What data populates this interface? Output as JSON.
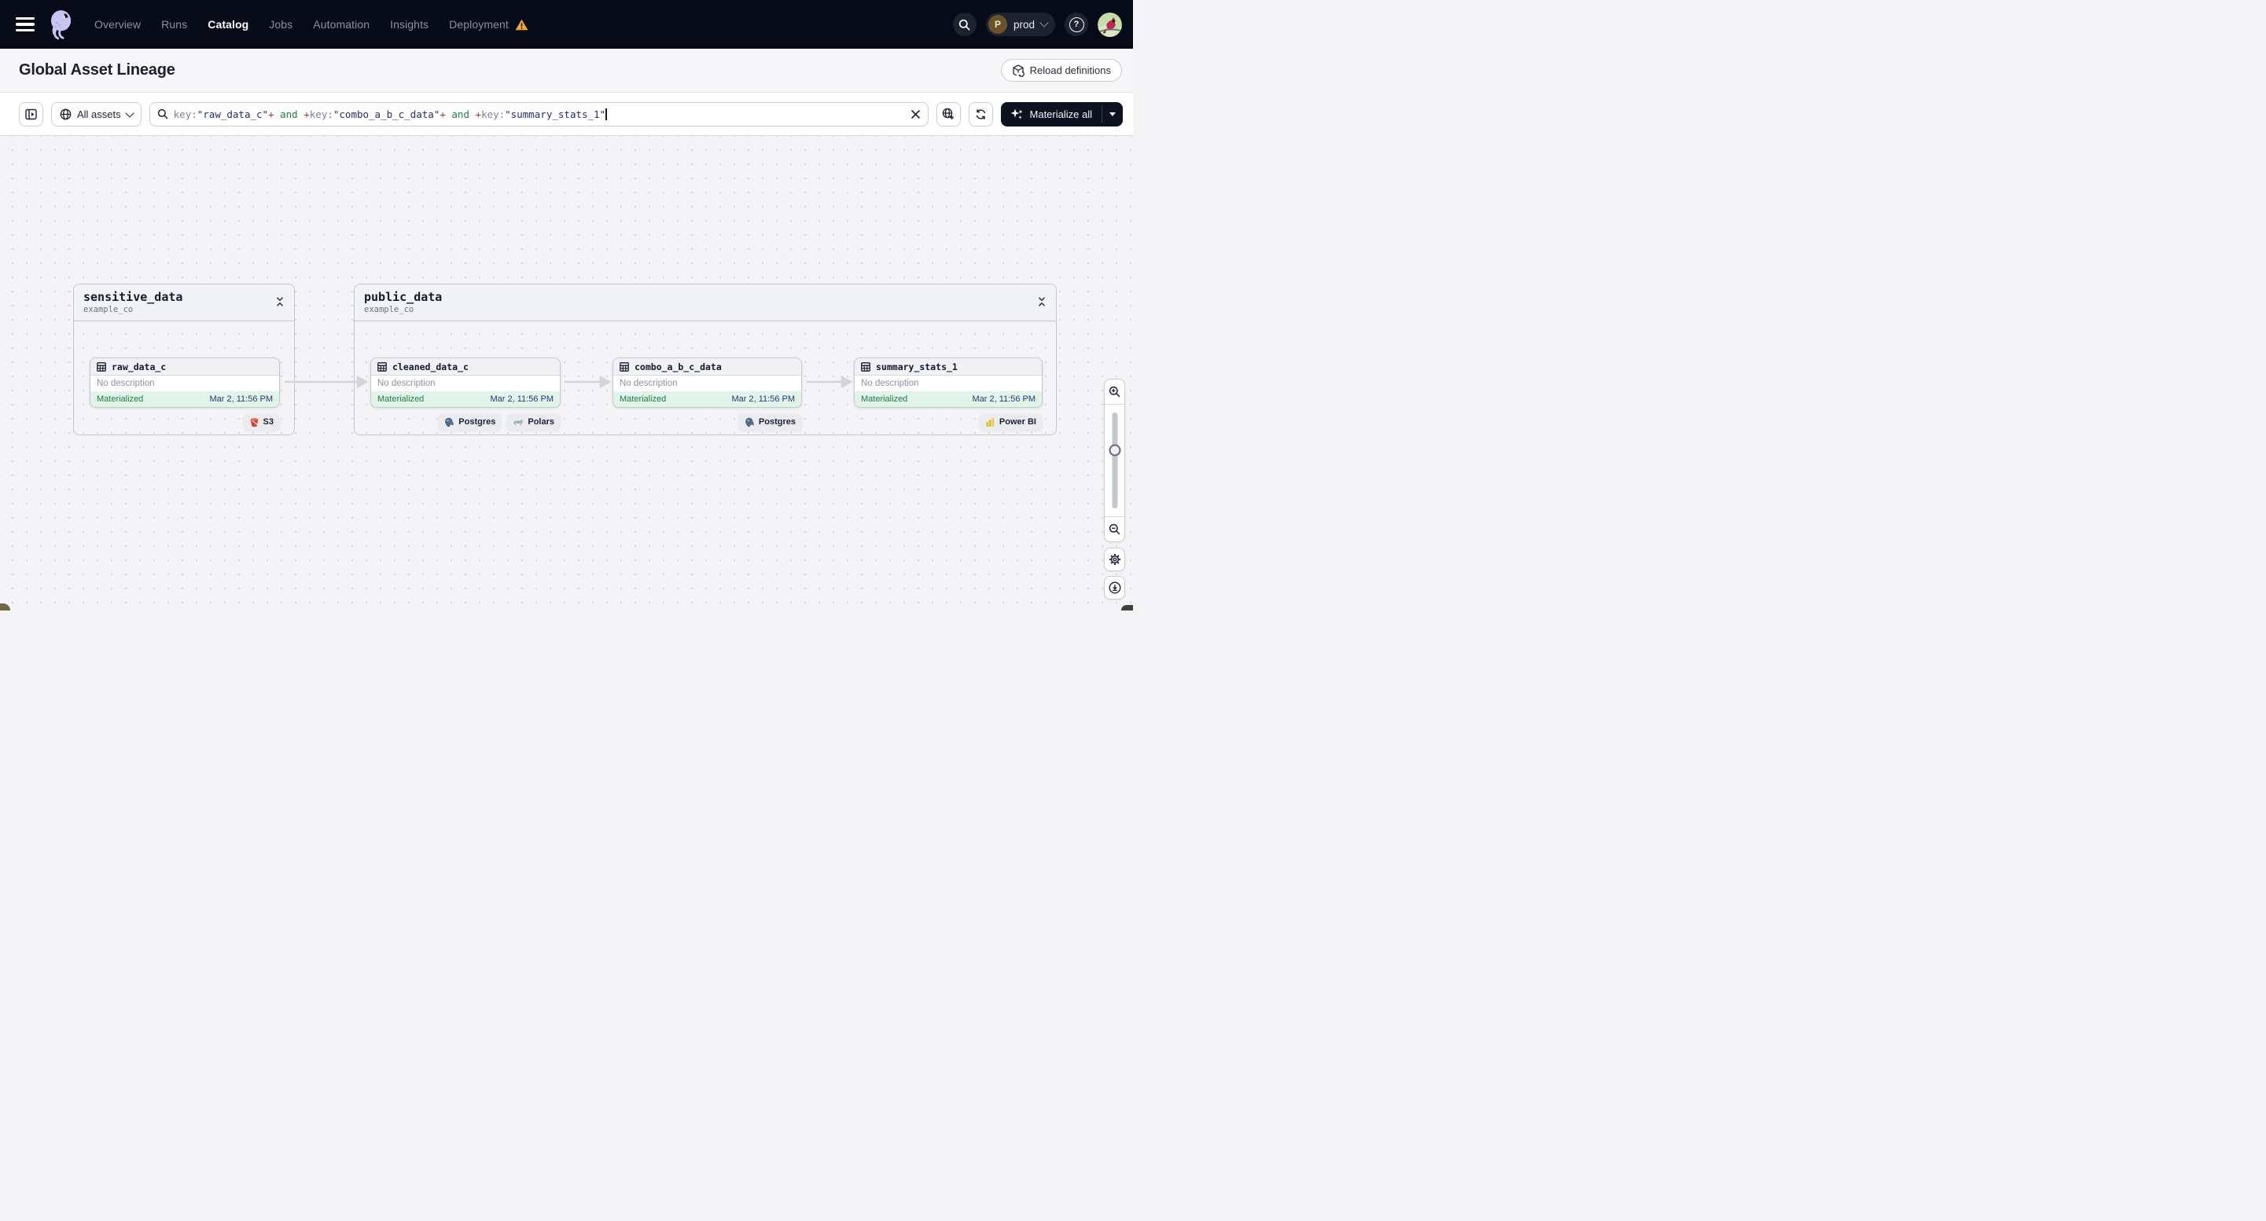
{
  "nav": {
    "items": [
      "Overview",
      "Runs",
      "Catalog",
      "Jobs",
      "Automation",
      "Insights",
      "Deployment"
    ],
    "active_item": "Catalog",
    "help_label": "?",
    "environment": {
      "initial": "P",
      "name": "prod"
    }
  },
  "page": {
    "title": "Global Asset Lineage",
    "reload_button": "Reload definitions"
  },
  "toolbar": {
    "scope_selector": "All assets",
    "materialize_button": "Materialize all",
    "query": [
      {
        "t": "key:",
        "c": "attr"
      },
      {
        "t": "\"raw_data_c\"",
        "c": "str"
      },
      {
        "t": "+",
        "c": "op"
      },
      {
        "t": " and ",
        "c": "kw"
      },
      {
        "t": "+",
        "c": "op"
      },
      {
        "t": "key:",
        "c": "attr"
      },
      {
        "t": "\"combo_a_b_c_data\"",
        "c": "str"
      },
      {
        "t": "+",
        "c": "op"
      },
      {
        "t": " and ",
        "c": "kw"
      },
      {
        "t": "+",
        "c": "op"
      },
      {
        "t": "key:",
        "c": "attr"
      },
      {
        "t": "\"summary_stats_1\"",
        "c": "str"
      }
    ]
  },
  "graph": {
    "groups": [
      {
        "name": "sensitive_data",
        "location": "example_co"
      },
      {
        "name": "public_data",
        "location": "example_co"
      }
    ],
    "nodes": [
      {
        "name": "raw_data_c",
        "description": "No description",
        "status": "Materialized",
        "timestamp": "Mar 2, 11:56 PM",
        "badges": [
          {
            "label": "S3",
            "icon": "s3"
          }
        ]
      },
      {
        "name": "cleaned_data_c",
        "description": "No description",
        "status": "Materialized",
        "timestamp": "Mar 2, 11:56 PM",
        "badges": [
          {
            "label": "Postgres",
            "icon": "postgres"
          },
          {
            "label": "Polars",
            "icon": "polars"
          }
        ]
      },
      {
        "name": "combo_a_b_c_data",
        "description": "No description",
        "status": "Materialized",
        "timestamp": "Mar 2, 11:56 PM",
        "badges": [
          {
            "label": "Postgres",
            "icon": "postgres"
          }
        ]
      },
      {
        "name": "summary_stats_1",
        "description": "No description",
        "status": "Materialized",
        "timestamp": "Mar 2, 11:56 PM",
        "badges": [
          {
            "label": "Power BI",
            "icon": "powerbi"
          }
        ]
      }
    ]
  },
  "colors": {
    "nav_bg": "#070B17",
    "accent_dark": "#0D1220",
    "materialized_green": "#1F7A48",
    "timestamp_navy": "#2B3778",
    "warning_orange": "#EBA63B",
    "query_string": "#232F6B",
    "query_operator": "#A13632",
    "query_keyword": "#1E7E45"
  }
}
